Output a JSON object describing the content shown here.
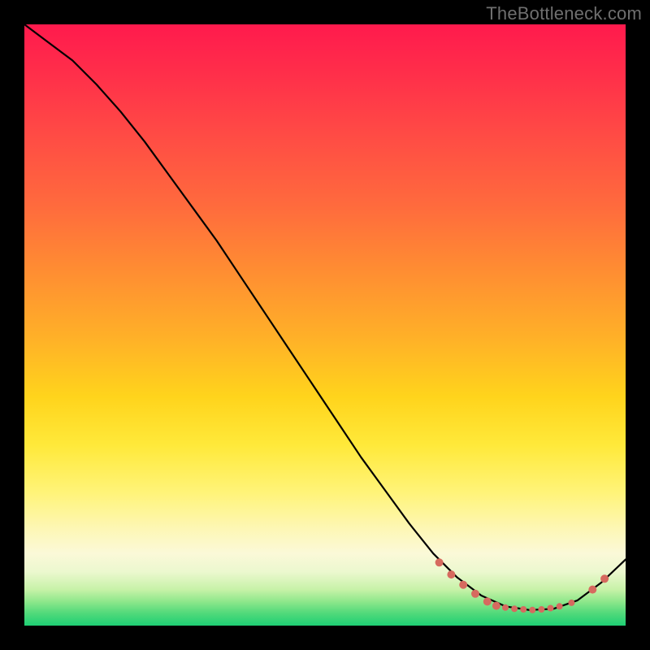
{
  "watermark": "TheBottleneck.com",
  "colors": {
    "background": "#000000",
    "curve": "#000000",
    "marker": "#d66a5f",
    "gradient_top": "#ff1a4d",
    "gradient_bottom": "#1ecf74"
  },
  "chart_data": {
    "type": "line",
    "title": "",
    "xlabel": "",
    "ylabel": "",
    "xlim": [
      0,
      100
    ],
    "ylim": [
      0,
      100
    ],
    "grid": false,
    "legend": false,
    "series": [
      {
        "name": "curve",
        "x": [
          0,
          4,
          8,
          12,
          16,
          20,
          24,
          28,
          32,
          36,
          40,
          44,
          48,
          52,
          56,
          60,
          64,
          68,
          72,
          76,
          80,
          84,
          88,
          92,
          96,
          100
        ],
        "y": [
          100,
          97,
          94,
          90,
          85.5,
          80.5,
          75,
          69.5,
          64,
          58,
          52,
          46,
          40,
          34,
          28,
          22.5,
          17,
          12,
          8,
          5,
          3.2,
          2.6,
          2.8,
          4.2,
          7.2,
          11
        ]
      }
    ],
    "markers": [
      {
        "x": 69,
        "y": 10.5,
        "r": 4.5
      },
      {
        "x": 71,
        "y": 8.5,
        "r": 4.5
      },
      {
        "x": 73,
        "y": 6.8,
        "r": 4.5
      },
      {
        "x": 75,
        "y": 5.3,
        "r": 4.5
      },
      {
        "x": 77,
        "y": 4.0,
        "r": 4.5
      },
      {
        "x": 78.5,
        "y": 3.3,
        "r": 4.5
      },
      {
        "x": 80,
        "y": 3.0,
        "r": 3.5
      },
      {
        "x": 81.5,
        "y": 2.8,
        "r": 3.5
      },
      {
        "x": 83,
        "y": 2.7,
        "r": 3.5
      },
      {
        "x": 84.5,
        "y": 2.6,
        "r": 3.5
      },
      {
        "x": 86,
        "y": 2.7,
        "r": 3.5
      },
      {
        "x": 87.5,
        "y": 2.9,
        "r": 3.5
      },
      {
        "x": 89,
        "y": 3.2,
        "r": 3.5
      },
      {
        "x": 91,
        "y": 3.8,
        "r": 3.5
      },
      {
        "x": 94.5,
        "y": 6.0,
        "r": 4.5
      },
      {
        "x": 96.5,
        "y": 7.8,
        "r": 4.5
      }
    ]
  }
}
